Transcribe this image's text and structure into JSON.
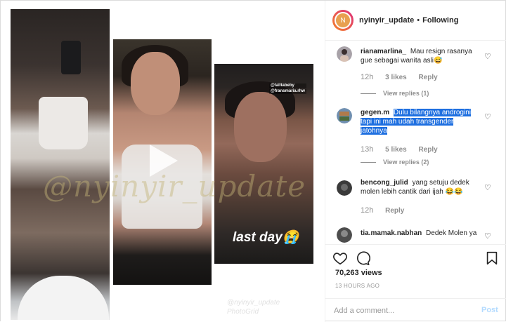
{
  "media": {
    "watermark": "@nyinyir_update",
    "watermark_small_line1": "@nyinyir_update",
    "watermark_small_line2": "PhotoGrid",
    "story_tag_1": "@talitabeby",
    "story_tag_2": "@fransmaria.rhw",
    "caption_overlay": "last day😭"
  },
  "header": {
    "avatar_initial": "N",
    "username": "nyinyir_update",
    "separator": "•",
    "follow_status": "Following"
  },
  "comments": [
    {
      "username": "rianamarlina_",
      "text": "Mau resign rasanya gue sebagai wanita asli😅",
      "text_highlight": "",
      "time": "12h",
      "likes": "3 likes",
      "reply": "Reply",
      "view_replies": "View replies (1)",
      "avatar_color": "#a8a2a8"
    },
    {
      "username": "gegen.m",
      "text": "",
      "text_highlight": "Dulu bilangnya androgini tapi ini mah udah transgender jatohnya",
      "time": "13h",
      "likes": "5 likes",
      "reply": "Reply",
      "view_replies": "View replies (2)",
      "avatar_color": "#6f8fb0"
    },
    {
      "username": "bencong_julid",
      "text": "yang setuju dedek molen lebih cantik dari ijah 😂😂",
      "text_highlight": "",
      "time": "12h",
      "likes": "",
      "reply": "Reply",
      "view_replies": "",
      "avatar_color": "#3a3a3a"
    },
    {
      "username": "tia.mamak.nabhan",
      "text": "Dedek Molen ya",
      "text_highlight": "",
      "time": "",
      "likes": "",
      "reply": "",
      "view_replies": "",
      "avatar_color": "#4d4d4d"
    }
  ],
  "actions": {
    "like_icon": "heart-icon",
    "comment_icon": "comment-icon",
    "save_icon": "bookmark-icon",
    "views": "70,263 views",
    "time_ago": "13 HOURS AGO"
  },
  "add_comment": {
    "placeholder": "Add a comment...",
    "post_label": "Post"
  },
  "colors": {
    "highlight": "#1e6fe0",
    "post_disabled": "#b3dbff",
    "muted": "#8e8e8e"
  }
}
